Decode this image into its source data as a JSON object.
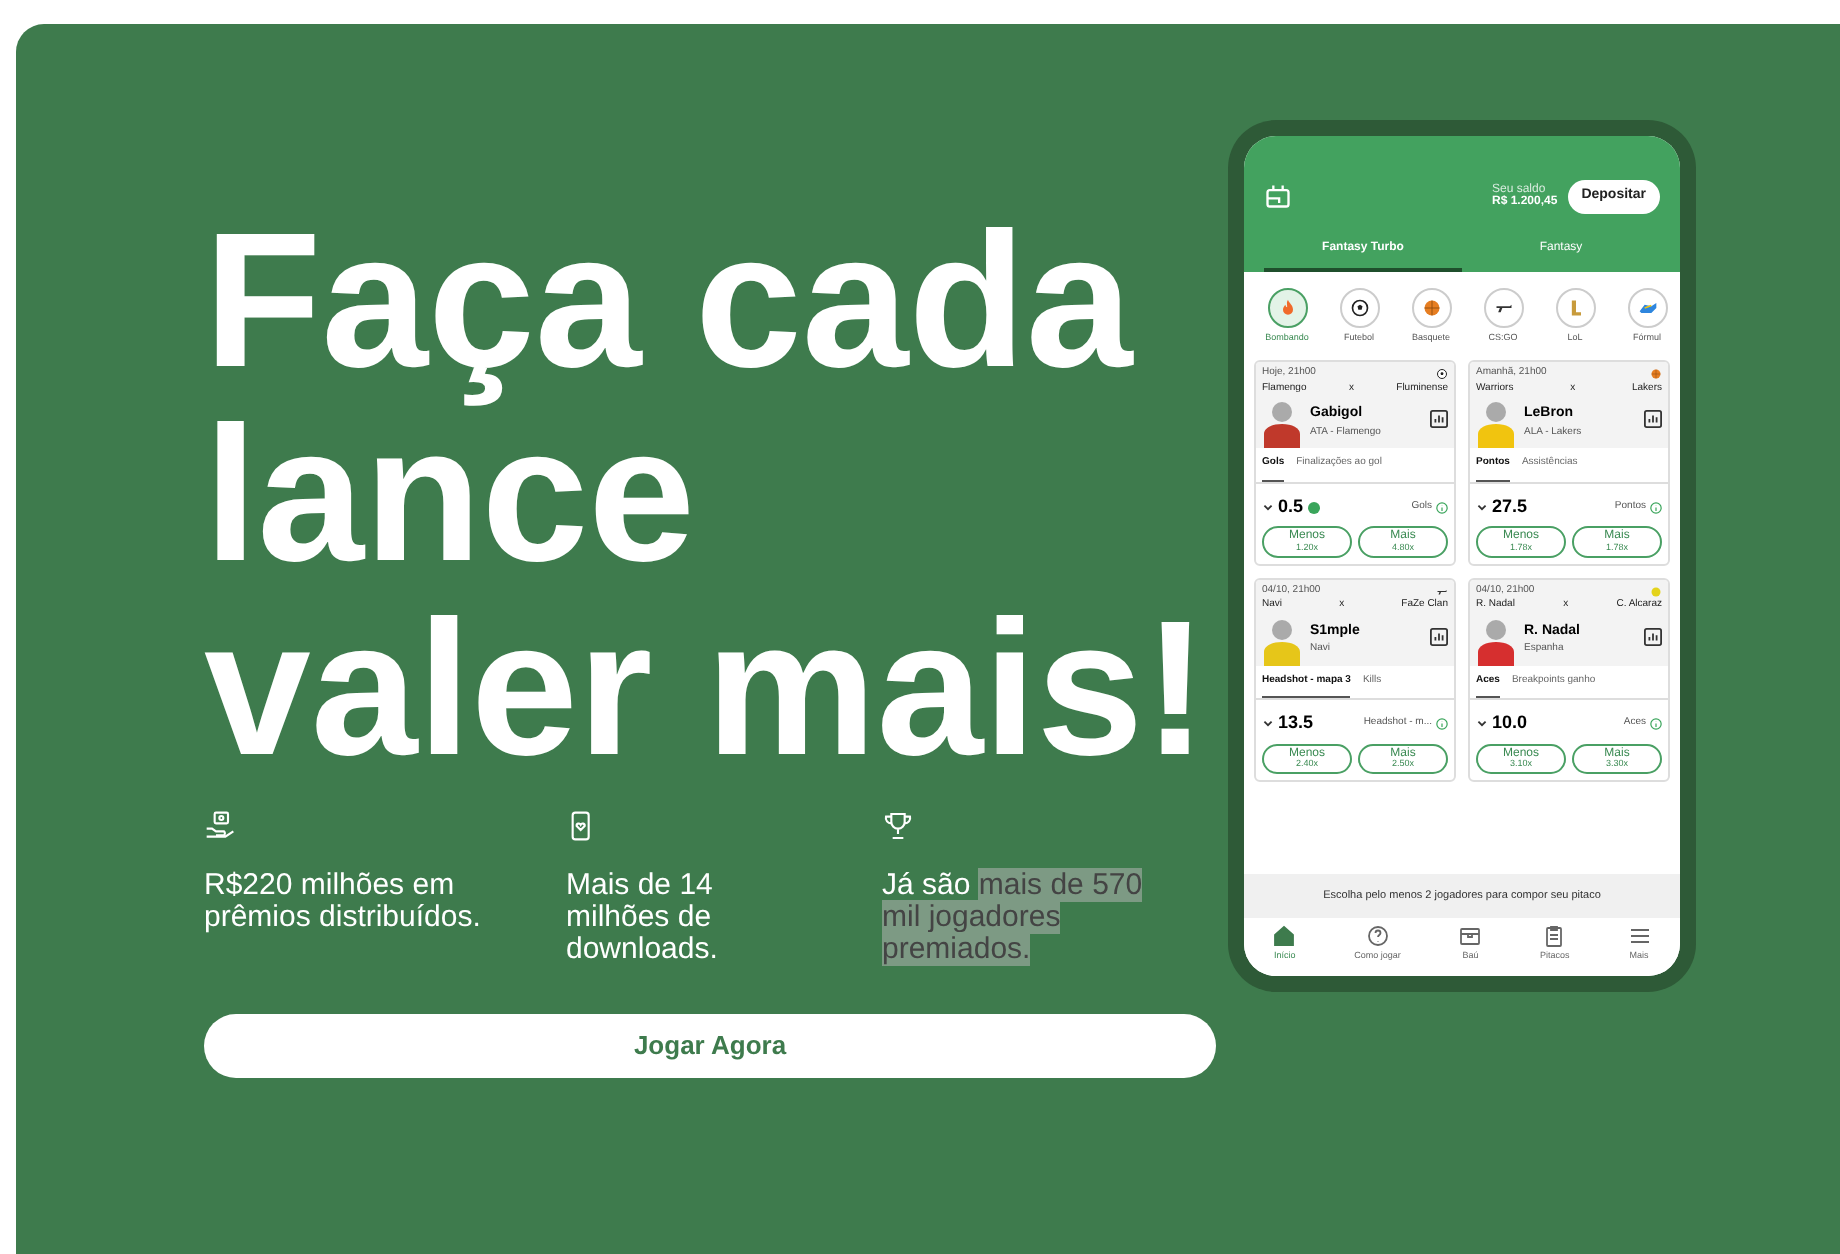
{
  "hero": {
    "headline_lines": [
      "Faça cada",
      "lance",
      "valer mais!"
    ],
    "features": [
      {
        "kind": "money",
        "text": "R$220 milhões em prêmios distribuídos."
      },
      {
        "kind": "phone",
        "text": "Mais de 14 milhões de downloads."
      },
      {
        "kind": "trophy",
        "text": "Já são ",
        "highlight": "mais de 570 mil jogadores premiados."
      }
    ],
    "cta": "Jogar Agora"
  },
  "phone": {
    "balance_label": "Seu saldo",
    "balance": "R$ 1.200,45",
    "deposit": "Depositar",
    "tabs": [
      {
        "label": "Fantasy Turbo",
        "selected": true
      },
      {
        "label": "Fantasy",
        "selected": false
      }
    ],
    "sports": [
      {
        "kind": "fire",
        "label": "Bombando",
        "selected": true
      },
      {
        "kind": "soccer",
        "label": "Futebol",
        "selected": false
      },
      {
        "kind": "basketball",
        "label": "Basquete",
        "selected": false
      },
      {
        "kind": "gun",
        "label": "CS:GO",
        "selected": false
      },
      {
        "kind": "lol",
        "label": "LoL",
        "selected": false
      },
      {
        "kind": "car",
        "label": "Fórmul",
        "selected": false
      }
    ],
    "cards": [
      {
        "kind": "soccer",
        "date": "Hoje, 21h00",
        "home": "Flamengo",
        "vs": "x",
        "away": "Fluminense",
        "player": "Gabigol",
        "team": "ATA - Flamengo",
        "color": "#c0392b",
        "stats": [
          {
            "label": "Gols",
            "selected": true
          },
          {
            "label": "Finalizações ao gol",
            "selected": false
          }
        ],
        "line": "0.5",
        "boost": true,
        "stat": "Gols",
        "odds": [
          {
            "label": "Menos",
            "value": "1.20x"
          },
          {
            "label": "Mais",
            "value": "4.80x"
          }
        ]
      },
      {
        "kind": "basketball",
        "date": "Amanhã, 21h00",
        "home": "Warriors",
        "vs": "x",
        "away": "Lakers",
        "player": "LeBron",
        "team": "ALA - Lakers",
        "color": "#f1c40f",
        "stats": [
          {
            "label": "Pontos",
            "selected": true
          },
          {
            "label": "Assistências",
            "selected": false
          }
        ],
        "line": "27.5",
        "boost": false,
        "stat": "Pontos",
        "odds": [
          {
            "label": "Menos",
            "value": "1.78x"
          },
          {
            "label": "Mais",
            "value": "1.78x"
          }
        ]
      },
      {
        "kind": "gun",
        "date": "04/10, 21h00",
        "home": "Navi",
        "vs": "x",
        "away": "FaZe Clan",
        "player": "S1mple",
        "team": "Navi",
        "color": "#e6c619",
        "stats": [
          {
            "label": "Headshot - mapa 3",
            "selected": true
          },
          {
            "label": "Kills",
            "selected": false
          }
        ],
        "line": "13.5",
        "boost": false,
        "stat": "Headshot - m...",
        "odds": [
          {
            "label": "Menos",
            "value": "2.40x"
          },
          {
            "label": "Mais",
            "value": "2.50x"
          }
        ]
      },
      {
        "kind": "tennis",
        "date": "04/10, 21h00",
        "home": "R. Nadal",
        "vs": "x",
        "away": "C. Alcaraz",
        "player": "R. Nadal",
        "team": "Espanha",
        "color": "#d62f2f",
        "stats": [
          {
            "label": "Aces",
            "selected": true
          },
          {
            "label": "Breakpoints ganho",
            "selected": false
          }
        ],
        "line": "10.0",
        "boost": false,
        "stat": "Aces",
        "odds": [
          {
            "label": "Menos",
            "value": "3.10x"
          },
          {
            "label": "Mais",
            "value": "3.30x"
          }
        ]
      }
    ],
    "hint": "Escolha pelo menos 2 jogadores para compor seu pitaco",
    "nav": [
      {
        "kind": "home",
        "label": "Início",
        "selected": true
      },
      {
        "kind": "help",
        "label": "Como jogar",
        "selected": false
      },
      {
        "kind": "chest",
        "label": "Baú",
        "selected": false
      },
      {
        "kind": "clipboard",
        "label": "Pitacos",
        "selected": false
      },
      {
        "kind": "menu",
        "label": "Mais",
        "selected": false
      }
    ]
  }
}
